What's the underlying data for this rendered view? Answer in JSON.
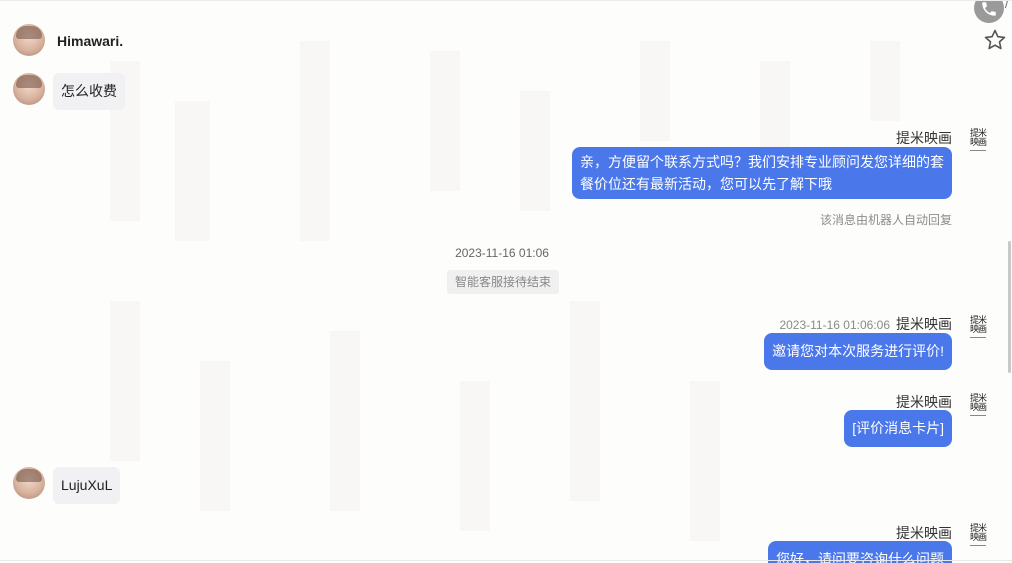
{
  "top_actions": {
    "call_icon": "phone-icon",
    "call_extra": "/",
    "star_icon": "star-icon"
  },
  "messages": [
    {
      "type": "customer",
      "name": "Himawari.",
      "text": "怎么收费"
    },
    {
      "type": "agent",
      "sender": "提米映画",
      "text_lines": [
        "亲，方便留个联系方式吗？我们安排专业顾问发您详细的套",
        "餐价位还有最新活动，您可以先了解下哦"
      ],
      "note": "该消息由机器人自动回复"
    },
    {
      "type": "divider",
      "time": "2023-11-16 01:06",
      "system": "智能客服接待结束"
    },
    {
      "type": "agent",
      "timestamp": "2023-11-16 01:06:06",
      "sender": "提米映画",
      "text": "邀请您对本次服务进行评价!"
    },
    {
      "type": "agent",
      "sender": "提米映画",
      "text": "[评价消息卡片]"
    },
    {
      "type": "customer",
      "text": "LujuXuL"
    },
    {
      "type": "agent",
      "sender": "提米映画",
      "text": "您好，请问要咨询什么问题"
    }
  ],
  "brand": {
    "line1": "提米",
    "line2": "映画"
  },
  "colors": {
    "agent_bubble": "#4a77ea",
    "customer_bubble": "#f1f1f3",
    "background": "#fdfdfc"
  }
}
